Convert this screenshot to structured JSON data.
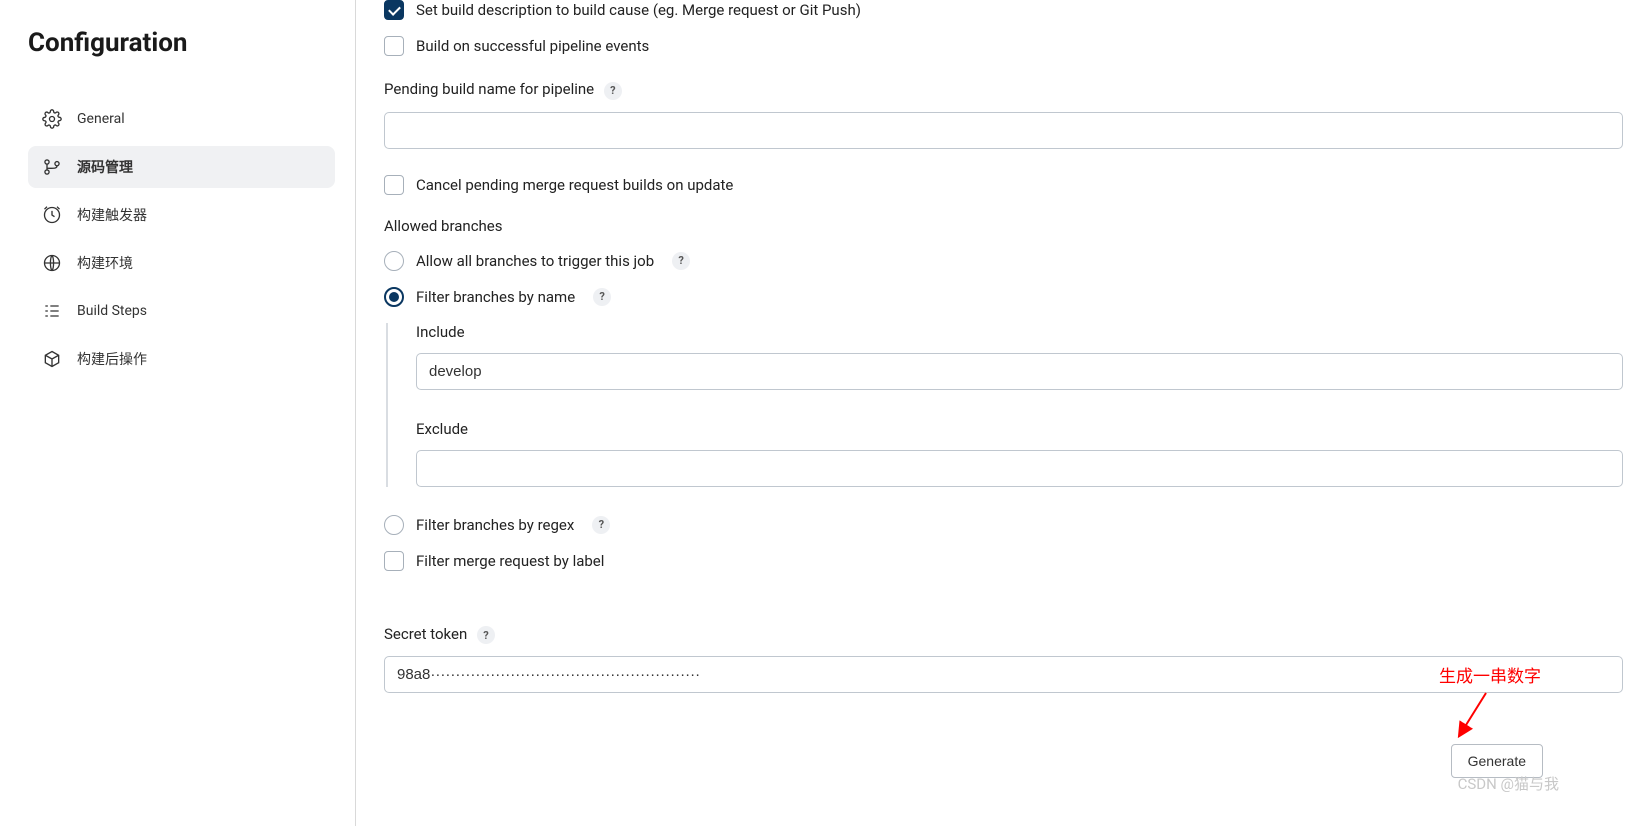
{
  "sidebar": {
    "title": "Configuration",
    "items": [
      {
        "label": "General"
      },
      {
        "label": "源码管理"
      },
      {
        "label": "构建触发器"
      },
      {
        "label": "构建环境"
      },
      {
        "label": "Build Steps"
      },
      {
        "label": "构建后操作"
      }
    ]
  },
  "main": {
    "set_build_desc": "Set build description to build cause (eg. Merge request or Git Push)",
    "build_on_pipeline": "Build on successful pipeline events",
    "pending_build_label": "Pending build name for pipeline",
    "pending_build_value": "",
    "cancel_pending": "Cancel pending merge request builds on update",
    "allowed_branches_head": "Allowed branches",
    "allow_all": "Allow all branches to trigger this job",
    "filter_by_name": "Filter branches by name",
    "include_label": "Include",
    "include_value": "develop",
    "exclude_label": "Exclude",
    "exclude_value": "",
    "filter_by_regex": "Filter branches by regex",
    "filter_mr_label": "Filter merge request by label",
    "secret_token_label": "Secret token",
    "secret_token_value": "98a8······················································",
    "generate_button": "Generate",
    "help_char": "?"
  },
  "annotation": "生成一串数字",
  "watermark": "CSDN @猫与我"
}
